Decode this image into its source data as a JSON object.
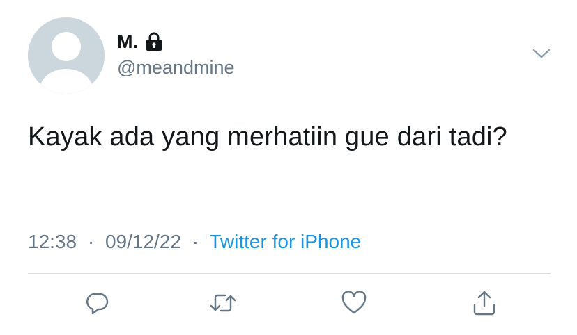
{
  "tweet": {
    "author": {
      "display_name": "M.",
      "handle": "@meandmine",
      "avatar_icon": "default-avatar-icon",
      "protected_icon": "lock-icon"
    },
    "text": "Kayak ada yang merhatiin gue dari tadi?",
    "time": "12:38",
    "separator": "·",
    "date": "09/12/22",
    "source": "Twitter for iPhone",
    "menu_icon": "chevron-down-icon",
    "actions": [
      {
        "icon": "reply-icon"
      },
      {
        "icon": "retweet-icon"
      },
      {
        "icon": "like-icon"
      },
      {
        "icon": "share-icon"
      }
    ]
  },
  "colors": {
    "primary_text": "#14171a",
    "secondary_text": "#657786",
    "link": "#1b95e0",
    "divider": "#d9dee2",
    "avatar_bg": "#ccd6dd",
    "icon": "#657786"
  }
}
